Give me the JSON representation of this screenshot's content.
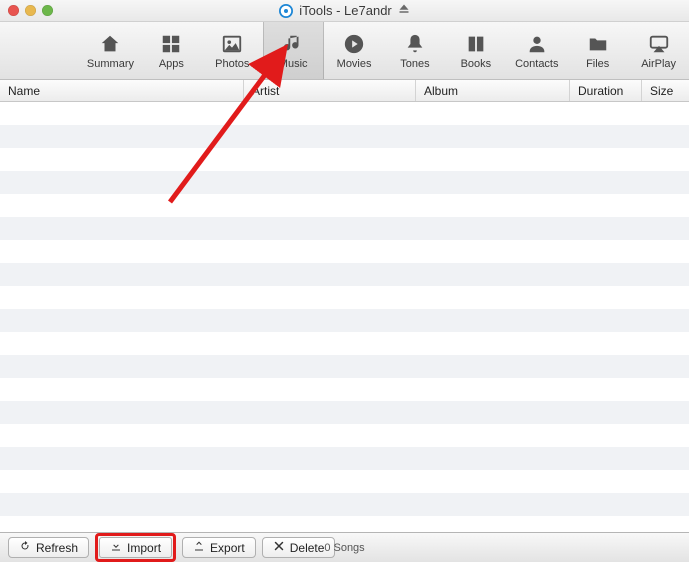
{
  "title": {
    "app": "iTools",
    "device": "Le7andr",
    "combined": "iTools - Le7andr"
  },
  "toolbar": {
    "items": [
      {
        "id": "summary",
        "label": "Summary"
      },
      {
        "id": "apps",
        "label": "Apps"
      },
      {
        "id": "photos",
        "label": "Photos"
      },
      {
        "id": "music",
        "label": "Music",
        "active": true
      },
      {
        "id": "movies",
        "label": "Movies"
      },
      {
        "id": "tones",
        "label": "Tones"
      },
      {
        "id": "books",
        "label": "Books"
      },
      {
        "id": "contacts",
        "label": "Contacts"
      },
      {
        "id": "files",
        "label": "Files"
      },
      {
        "id": "airplay",
        "label": "AirPlay"
      }
    ]
  },
  "columns": {
    "name": "Name",
    "artist": "Artist",
    "album": "Album",
    "duration": "Duration",
    "size": "Size"
  },
  "rows": [],
  "bottom": {
    "refresh": "Refresh",
    "import": "Import",
    "export": "Export",
    "delete": "Delete",
    "status": "0 Songs"
  }
}
